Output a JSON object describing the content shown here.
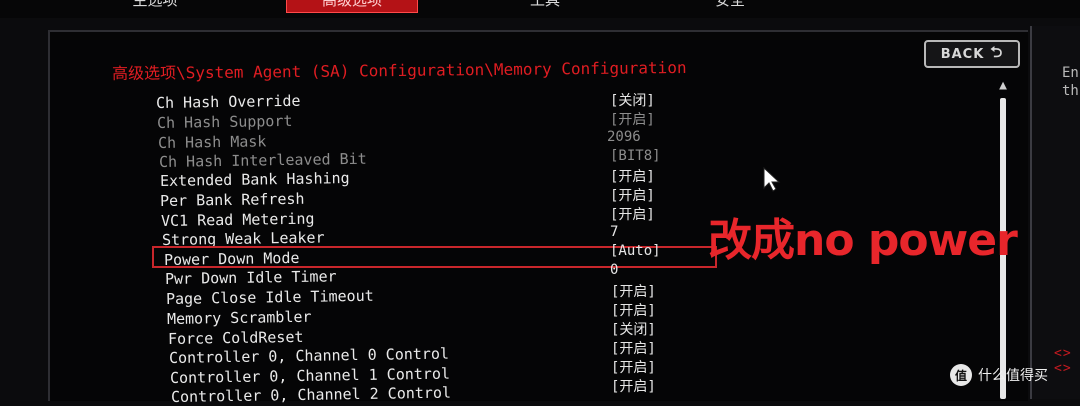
{
  "tabs": [
    {
      "label": "主选项",
      "active": false
    },
    {
      "label": "高级选项",
      "active": true
    },
    {
      "label": "工具",
      "active": false
    },
    {
      "label": "安全",
      "active": false
    }
  ],
  "back_button": {
    "label": "BACK",
    "icon": "return-arrow-icon"
  },
  "breadcrumb": "高级选项\\System Agent (SA) Configuration\\Memory Configuration",
  "settings": [
    {
      "name": "Ch Hash Override",
      "value": "[关闭]",
      "enabled": true
    },
    {
      "name": "Ch Hash Support",
      "value": "[开启]",
      "enabled": false
    },
    {
      "name": "Ch Hash Mask",
      "value": "2096",
      "enabled": false
    },
    {
      "name": "Ch Hash Interleaved Bit",
      "value": "[BIT8]",
      "enabled": false
    },
    {
      "name": "Extended Bank Hashing",
      "value": "[开启]",
      "enabled": true
    },
    {
      "name": "Per Bank Refresh",
      "value": "[开启]",
      "enabled": true
    },
    {
      "name": "VC1 Read Metering",
      "value": "[开启]",
      "enabled": true
    },
    {
      "name": "Strong Weak Leaker",
      "value": "7",
      "enabled": true
    },
    {
      "name": "Power Down Mode",
      "value": "[Auto]",
      "enabled": true,
      "highlighted": true
    },
    {
      "name": "Pwr Down Idle Timer",
      "value": "0",
      "enabled": true
    },
    {
      "name": "Page Close Idle Timeout",
      "value": "[开启]",
      "enabled": true
    },
    {
      "name": "Memory Scrambler",
      "value": "[开启]",
      "enabled": true
    },
    {
      "name": "Force ColdReset",
      "value": "[关闭]",
      "enabled": true
    },
    {
      "name": "Controller 0, Channel 0 Control",
      "value": "[开启]",
      "enabled": true
    },
    {
      "name": "Controller 0, Channel 1 Control",
      "value": "[开启]",
      "enabled": true
    },
    {
      "name": "Controller 0, Channel 2 Control",
      "value": "[开启]",
      "enabled": true
    }
  ],
  "annotation": "改成no power",
  "help_panel": {
    "line1": "En",
    "line2": "th",
    "arrows": "<> <>"
  },
  "watermark": {
    "logo": "值",
    "text": "什么值得买"
  },
  "colors": {
    "accent_red": "#e11d22",
    "active_tab": "#b41216",
    "text": "#eaeaea",
    "disabled_text": "#8d8d8d"
  }
}
